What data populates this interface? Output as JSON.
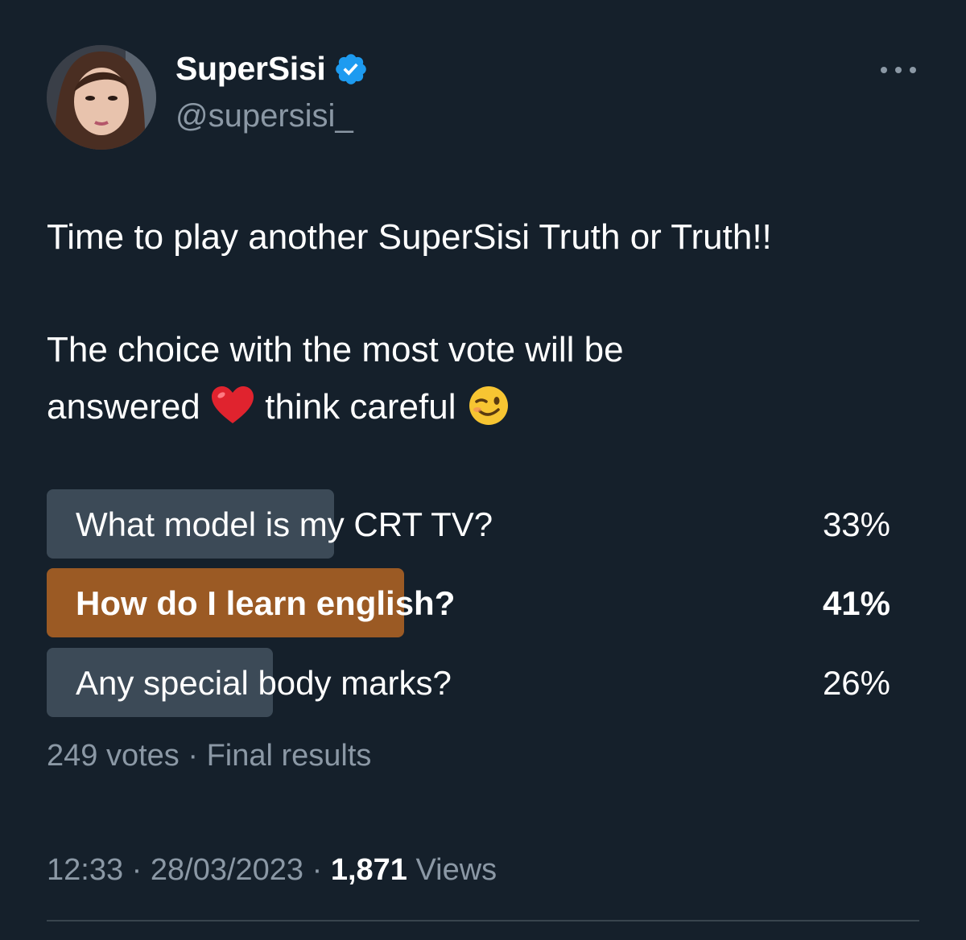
{
  "author": {
    "display_name": "SuperSisi",
    "handle": "@supersisi_",
    "verified_icon": "verified-badge-icon",
    "avatar": "avatar-photo"
  },
  "menu": {
    "more_icon": "more-horizontal-icon"
  },
  "tweet": {
    "line1": "Time to play another SuperSisi Truth or Truth!!",
    "line2": "The choice  with the most vote will be",
    "line3_a": "answered ",
    "line3_b": " think careful ",
    "emojis": [
      "red-heart-emoji",
      "winking-face-emoji"
    ]
  },
  "poll": {
    "options": [
      {
        "label": "What model is my CRT TV?",
        "percent_text": "33%",
        "percent": 33,
        "winner": false
      },
      {
        "label": "How do I learn english?",
        "percent_text": "41%",
        "percent": 41,
        "winner": true
      },
      {
        "label": "Any special body marks?",
        "percent_text": "26%",
        "percent": 26,
        "winner": false
      }
    ],
    "votes": "249 votes",
    "separator": "·",
    "status": "Final results"
  },
  "meta": {
    "time": "12:33",
    "date": "28/03/2023",
    "separator": "·",
    "views_count": "1,871",
    "views_label": "Views"
  },
  "colors": {
    "background": "#15202b",
    "poll_bar": "#3c4a57",
    "poll_bar_winner": "#9b5a24",
    "secondary_text": "#8b98a5",
    "verified": "#1d9bf0"
  }
}
